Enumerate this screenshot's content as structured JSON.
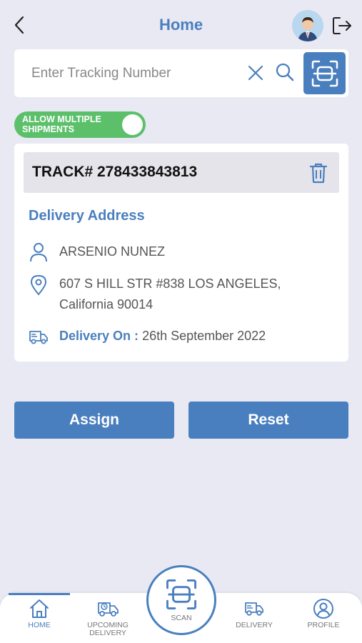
{
  "header": {
    "title": "Home",
    "back_icon": "chevron-left-icon",
    "avatar_icon": "user-avatar",
    "logout_icon": "logout-icon"
  },
  "search": {
    "placeholder": "Enter Tracking Number",
    "value": "",
    "clear_icon": "close-icon",
    "search_icon": "search-icon",
    "scan_icon": "barcode-scan-icon"
  },
  "toggle": {
    "label": "ALLOW MULTIPLE SHIPMENTS",
    "on": true
  },
  "shipment": {
    "track_label": "TRACK# 278433843813",
    "delete_icon": "trash-icon",
    "section_title": "Delivery Address",
    "name": "ARSENIO NUNEZ",
    "address_line1": "607 S HILL STR #838 LOS ANGELES,",
    "address_line2": "California 90014",
    "delivery_label": "Delivery On :",
    "delivery_date": "26th September 2022"
  },
  "actions": {
    "assign": "Assign",
    "reset": "Reset"
  },
  "nav": {
    "items": [
      {
        "label": "HOME",
        "icon": "home-icon"
      },
      {
        "label": "UPCOMING DELIVERY",
        "icon": "upcoming-delivery-icon"
      },
      {
        "label": "SCAN",
        "icon": "barcode-scan-icon"
      },
      {
        "label": "DELIVERY",
        "icon": "delivery-truck-icon"
      },
      {
        "label": "PROFILE",
        "icon": "profile-icon"
      }
    ],
    "active": "HOME"
  },
  "colors": {
    "primary": "#4a7fbf",
    "toggle_on": "#5cc06b",
    "background": "#e9e9f3"
  }
}
